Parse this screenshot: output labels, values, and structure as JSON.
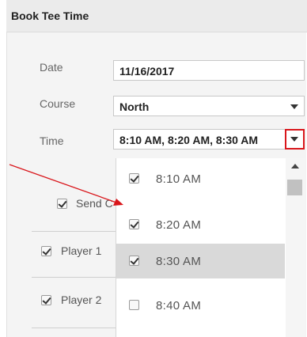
{
  "dialog": {
    "title": "Book Tee Time"
  },
  "form": {
    "date_label": "Date",
    "date_value": "11/16/2017",
    "course_label": "Course",
    "course_value": "North",
    "time_label": "Time",
    "time_value": "8:10 AM, 8:20 AM, 8:30 AM"
  },
  "options": {
    "send_label": "Send C",
    "players": [
      {
        "label": "Player 1",
        "checked": true
      },
      {
        "label": "Player 2",
        "checked": true
      }
    ]
  },
  "time_dropdown": {
    "items": [
      {
        "label": "8:10 AM",
        "checked": true
      },
      {
        "label": "8:20 AM",
        "checked": true
      },
      {
        "label": "8:30 AM",
        "checked": true,
        "highlighted": true
      },
      {
        "label": "8:40 AM",
        "checked": false
      }
    ]
  },
  "colors": {
    "annotation_red": "#d9161b",
    "highlight": "#d9d9d9"
  }
}
